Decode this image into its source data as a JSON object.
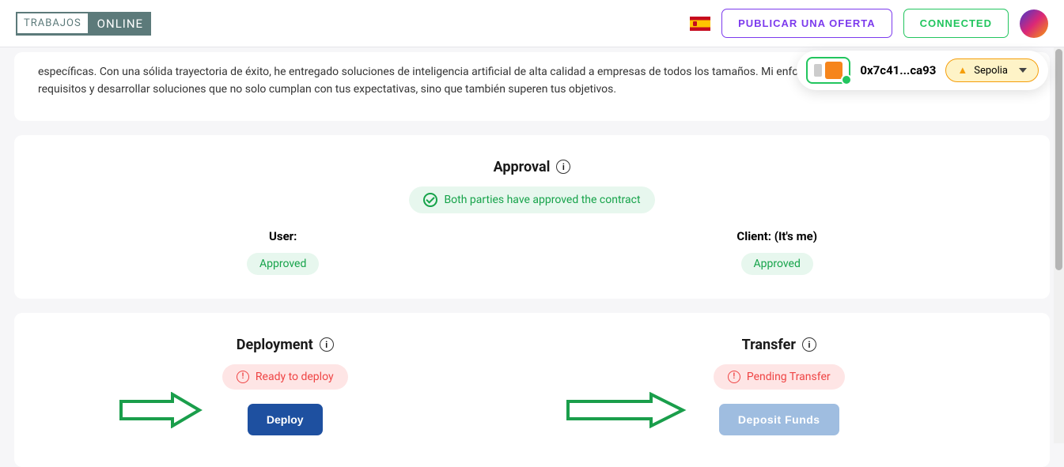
{
  "header": {
    "logo_left": "TRABAJOS",
    "logo_right": "ONLINE",
    "publish_label": "PUBLICAR UNA OFERTA",
    "connected_label": "CONNECTED"
  },
  "wallet": {
    "address": "0x7c41...ca93",
    "network": "Sepolia"
  },
  "description": {
    "text": "específicas. Con una sólida trayectoria de éxito, he entregado soluciones de inteligencia artificial de alta calidad a empresas de todos los tamaños. Mi enfoque radica en comprender a fondo tus requisitos y desarrollar soluciones que no solo cumplan con tus expectativas, sino que también superen tus objetivos."
  },
  "approval": {
    "title": "Approval",
    "status": "Both parties have approved the contract",
    "user_label": "User:",
    "client_label": "Client: (It's me)",
    "user_status": "Approved",
    "client_status": "Approved"
  },
  "deployment": {
    "title": "Deployment",
    "status": "Ready to deploy",
    "button": "Deploy"
  },
  "transfer": {
    "title": "Transfer",
    "status": "Pending Transfer",
    "button": "Deposit Funds"
  },
  "info_glyph": "i",
  "alert_glyph": "!"
}
